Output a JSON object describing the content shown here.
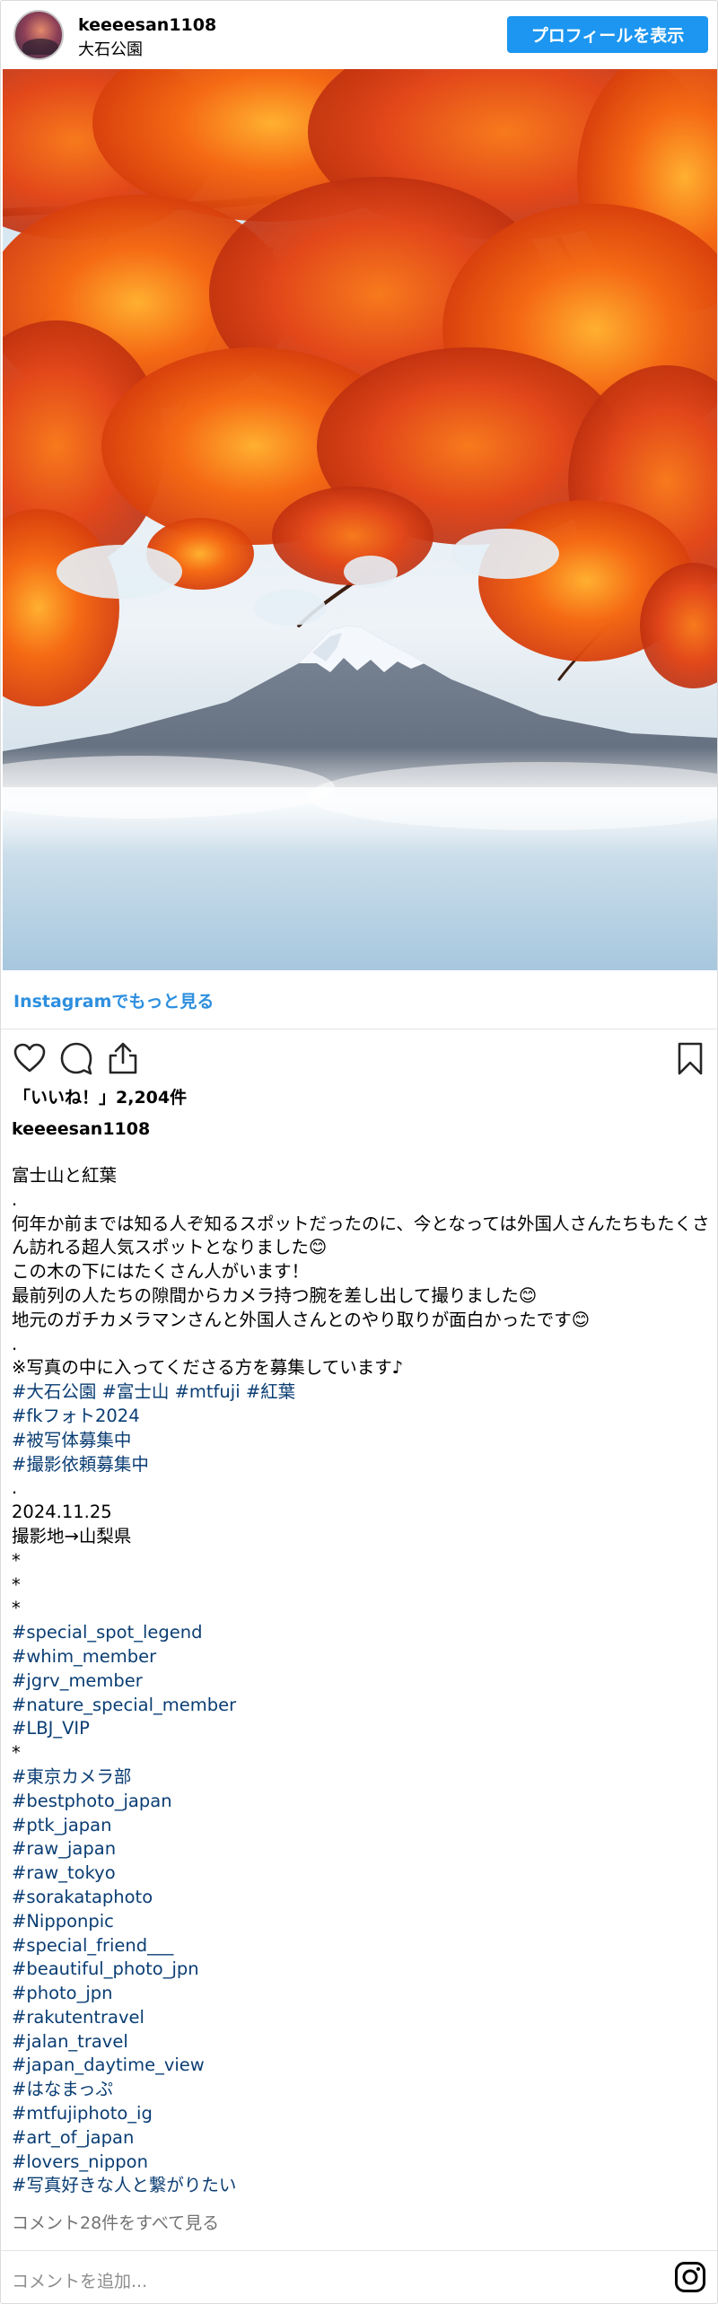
{
  "header": {
    "username": "keeeesan1108",
    "location": "大石公園",
    "profile_button": "プロフィールを表示"
  },
  "links": {
    "more_on_instagram": "Instagramでもっと見る",
    "view_all_comments": "コメント28件をすべて見る"
  },
  "actions": {
    "icons": [
      "heart-icon",
      "comment-icon",
      "share-icon",
      "bookmark-icon"
    ]
  },
  "likes": "「いいね！」2,204件",
  "caption": {
    "username": "keeeesan1108",
    "lines": [
      {
        "text": "富士山と紅葉",
        "tag": false
      },
      {
        "text": ".",
        "tag": false
      },
      {
        "text": "何年か前までは知る人ぞ知るスポットだったのに、今となっては外国人さんたちもたくさん訪れる超人気スポットとなりました😊",
        "tag": false
      },
      {
        "text": "この木の下にはたくさん人がいます！",
        "tag": false
      },
      {
        "text": "最前列の人たちの隙間からカメラ持つ腕を差し出して撮りました😊",
        "tag": false
      },
      {
        "text": "地元のガチカメラマンさんと外国人さんとのやり取りが面白かったです😊",
        "tag": false
      },
      {
        "text": ".",
        "tag": false
      },
      {
        "text": "※写真の中に入ってくださる方を募集しています♪",
        "tag": false
      },
      {
        "text": "#大石公園 #富士山 #mtfuji #紅葉",
        "tag": true
      },
      {
        "text": "#fkフォト2024",
        "tag": true
      },
      {
        "text": "#被写体募集中",
        "tag": true
      },
      {
        "text": "#撮影依頼募集中",
        "tag": true
      },
      {
        "text": ".",
        "tag": false
      },
      {
        "text": "2024.11.25",
        "tag": false
      },
      {
        "text": "撮影地→山梨県",
        "tag": false
      },
      {
        "text": "*",
        "tag": false
      },
      {
        "text": "*",
        "tag": false
      },
      {
        "text": "*",
        "tag": false
      },
      {
        "text": "#special_spot_legend",
        "tag": true
      },
      {
        "text": "#whim_member",
        "tag": true
      },
      {
        "text": "#jgrv_member",
        "tag": true
      },
      {
        "text": "#nature_special_member",
        "tag": true
      },
      {
        "text": "#LBJ_VIP",
        "tag": true
      },
      {
        "text": "*",
        "tag": false
      },
      {
        "text": "#東京カメラ部",
        "tag": true
      },
      {
        "text": "#bestphoto_japan",
        "tag": true
      },
      {
        "text": "#ptk_japan",
        "tag": true
      },
      {
        "text": "#raw_japan",
        "tag": true
      },
      {
        "text": "#raw_tokyo",
        "tag": true
      },
      {
        "text": "#sorakataphoto",
        "tag": true
      },
      {
        "text": "#Nipponpic",
        "tag": true
      },
      {
        "text": "#special_friend___",
        "tag": true
      },
      {
        "text": "#beautiful_photo_jpn",
        "tag": true
      },
      {
        "text": "#photo_jpn",
        "tag": true
      },
      {
        "text": "#rakutentravel",
        "tag": true
      },
      {
        "text": "#jalan_travel",
        "tag": true
      },
      {
        "text": "#japan_daytime_view",
        "tag": true
      },
      {
        "text": "#はなまっぷ",
        "tag": true
      },
      {
        "text": "#mtfujiphoto_ig",
        "tag": true
      },
      {
        "text": "#art_of_japan",
        "tag": true
      },
      {
        "text": "#lovers_nippon",
        "tag": true
      },
      {
        "text": "#写真好きな人と繋がりたい",
        "tag": true
      }
    ]
  },
  "comment_input": {
    "placeholder": "コメントを追加..."
  },
  "colors": {
    "accent": "#1c96f0",
    "hashtag": "#0a3d73",
    "link": "#2d8fdf",
    "muted": "#737373"
  }
}
